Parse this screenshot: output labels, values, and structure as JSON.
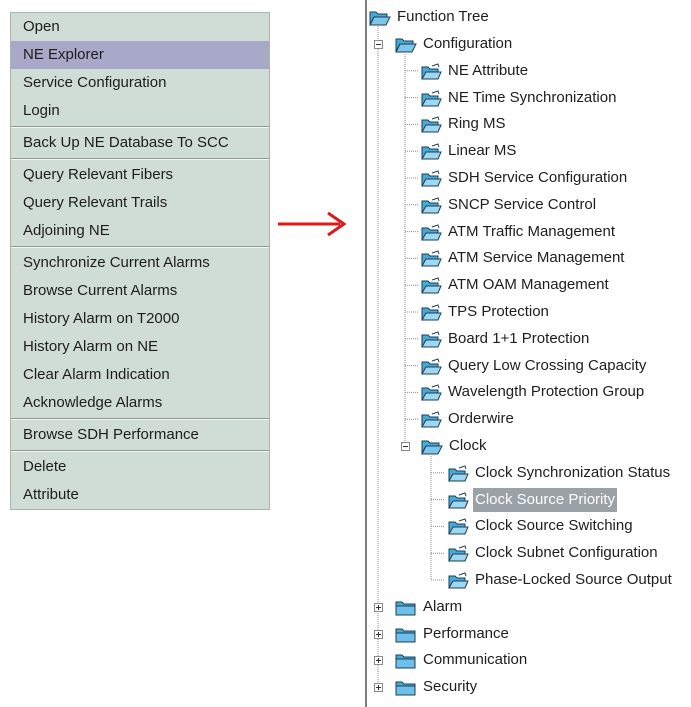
{
  "context_menu": {
    "groups": [
      [
        "Open",
        "NE Explorer",
        "Service Configuration",
        "Login"
      ],
      [
        "Back Up NE Database To SCC"
      ],
      [
        "Query Relevant Fibers",
        "Query Relevant Trails",
        "Adjoining NE"
      ],
      [
        "Synchronize Current Alarms",
        "Browse Current Alarms",
        "History Alarm on T2000",
        "History Alarm on NE",
        "Clear Alarm Indication",
        "Acknowledge Alarms"
      ],
      [
        "Browse SDH Performance"
      ],
      [
        "Delete",
        "Attribute"
      ]
    ],
    "selected": "NE Explorer"
  },
  "tree": {
    "root": "Function Tree",
    "configuration": {
      "label": "Configuration",
      "items": [
        "NE Attribute",
        "NE Time Synchronization",
        "Ring MS",
        "Linear MS",
        "SDH Service Configuration",
        "SNCP Service Control",
        "ATM Traffic Management",
        "ATM Service Management",
        "ATM OAM Management",
        "TPS Protection",
        "Board 1+1 Protection",
        "Query Low Crossing Capacity",
        "Wavelength Protection Group",
        "Orderwire"
      ],
      "clock": {
        "label": "Clock",
        "items": [
          "Clock Synchronization Status",
          "Clock Source Priority",
          "Clock Source Switching",
          "Clock Subnet Configuration",
          "Phase-Locked Source Output"
        ],
        "selected": "Clock Source Priority"
      }
    },
    "collapsed": [
      "Alarm",
      "Performance",
      "Communication",
      "Security"
    ]
  },
  "colors": {
    "menu_bg": "#d0dcd6",
    "menu_selected": "#a8a8c8",
    "tree_selected": "#9aa2a8",
    "arrow": "#e01818",
    "folder_fill": "#47a9d8"
  }
}
